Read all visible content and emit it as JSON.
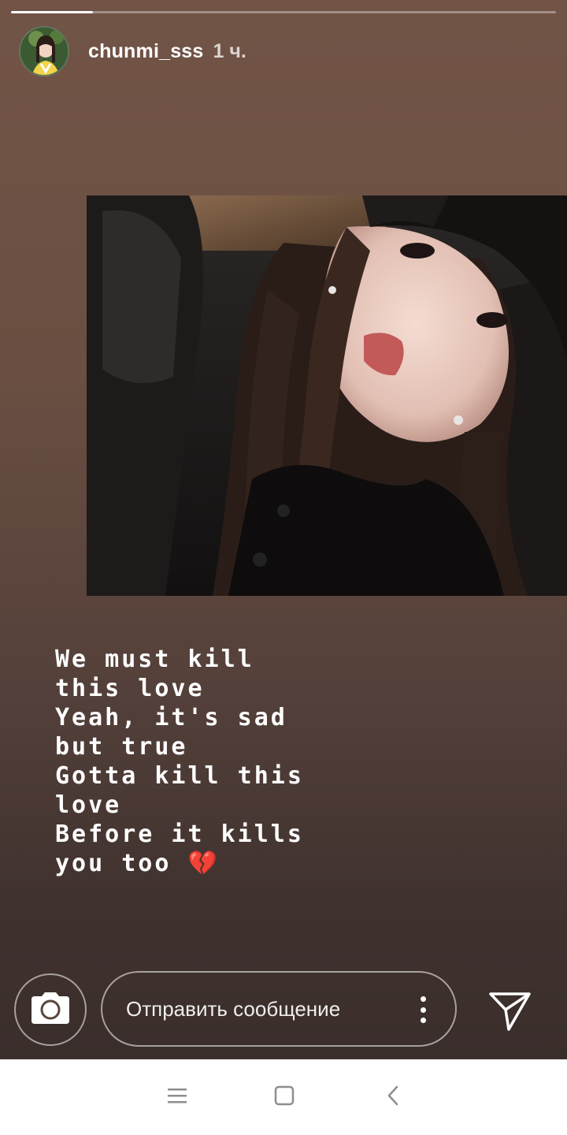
{
  "story": {
    "progress": 0.15,
    "username": "chunmi_sss",
    "time": "1 ч.",
    "caption": "We must kill\nthis love\nYeah, it's sad\nbut true\nGotta kill this\nlove\nBefore it kills\nyou too 💔"
  },
  "reply": {
    "placeholder": "Отправить сообщение"
  },
  "icons": {
    "camera": "camera-icon",
    "more": "more-vertical-icon",
    "send": "send-icon",
    "nav_menu": "menu-icon",
    "nav_home": "home-square-icon",
    "nav_back": "back-chevron-icon"
  },
  "colors": {
    "background_top": "#715446",
    "background_bottom": "#3a2e2b"
  }
}
